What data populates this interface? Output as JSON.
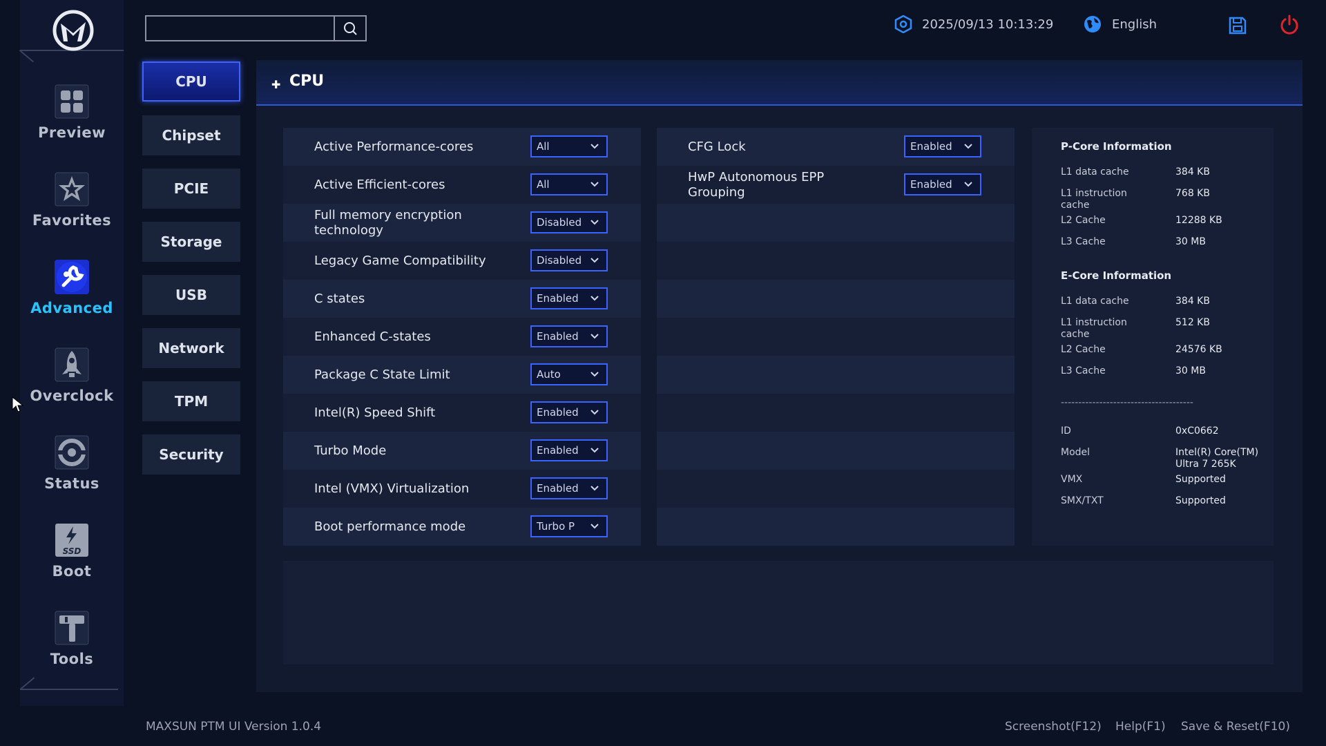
{
  "nav": {
    "items": [
      {
        "label": "Preview",
        "icon": "grid-icon"
      },
      {
        "label": "Favorites",
        "icon": "star-icon"
      },
      {
        "label": "Advanced",
        "icon": "wrench-icon",
        "active": true
      },
      {
        "label": "Overclock",
        "icon": "rocket-icon"
      },
      {
        "label": "Status",
        "icon": "gauge-icon"
      },
      {
        "label": "Boot",
        "icon": "ssd-icon"
      },
      {
        "label": "Tools",
        "icon": "hammer-icon"
      }
    ]
  },
  "topbar": {
    "search_value": "",
    "datetime": "2025/09/13 10:13:29",
    "language": "English"
  },
  "submenu": {
    "items": [
      "CPU",
      "Chipset",
      "PCIE",
      "Storage",
      "USB",
      "Network",
      "TPM",
      "Security"
    ],
    "active": "CPU"
  },
  "page": {
    "title": "CPU"
  },
  "settings_left": [
    {
      "label": "Active Performance-cores",
      "value": "All"
    },
    {
      "label": "Active Efficient-cores",
      "value": "All"
    },
    {
      "label": "Full memory encryption technology",
      "value": "Disabled"
    },
    {
      "label": "Legacy Game Compatibility",
      "value": "Disabled"
    },
    {
      "label": "C states",
      "value": "Enabled"
    },
    {
      "label": "Enhanced C-states",
      "value": "Enabled"
    },
    {
      "label": "Package C State Limit",
      "value": "Auto"
    },
    {
      "label": "Intel(R) Speed Shift",
      "value": "Enabled"
    },
    {
      "label": "Turbo Mode",
      "value": "Enabled"
    },
    {
      "label": "Intel (VMX) Virtualization",
      "value": "Enabled"
    },
    {
      "label": "Boot performance mode",
      "value": "Turbo P"
    }
  ],
  "settings_right": [
    {
      "label": "CFG Lock",
      "value": "Enabled"
    },
    {
      "label": "HwP Autonomous EPP Grouping",
      "value": "Enabled"
    }
  ],
  "info": {
    "pcore_title": "P-Core Information",
    "pcore": [
      {
        "k": "L1 data cache",
        "v": "384 KB"
      },
      {
        "k": "L1 instruction cache",
        "v": "768 KB"
      },
      {
        "k": "L2 Cache",
        "v": "12288 KB"
      },
      {
        "k": "L3 Cache",
        "v": "30 MB"
      }
    ],
    "ecore_title": "E-Core Information",
    "ecore": [
      {
        "k": "L1 data cache",
        "v": "384 KB"
      },
      {
        "k": "L1 instruction cache",
        "v": "512 KB"
      },
      {
        "k": "L2 Cache",
        "v": "24576 KB"
      },
      {
        "k": "L3 Cache",
        "v": "30 MB"
      }
    ],
    "separator": "--------------------------------------",
    "cpu": [
      {
        "k": "ID",
        "v": "0xC0662"
      },
      {
        "k": "Model",
        "v": "Intel(R) Core(TM) Ultra 7 265K"
      },
      {
        "k": "VMX",
        "v": "Supported"
      },
      {
        "k": "SMX/TXT",
        "v": "Supported"
      }
    ]
  },
  "footer": {
    "version": "MAXSUN PTM UI Version 1.0.4",
    "screenshot": "Screenshot(F12)",
    "help": "Help(F1)",
    "save_reset": "Save & Reset(F10)"
  },
  "colors": {
    "accent": "#3c63ff",
    "active_nav": "#29c4ff",
    "power": "#e0252a",
    "save": "#2f8cff"
  }
}
